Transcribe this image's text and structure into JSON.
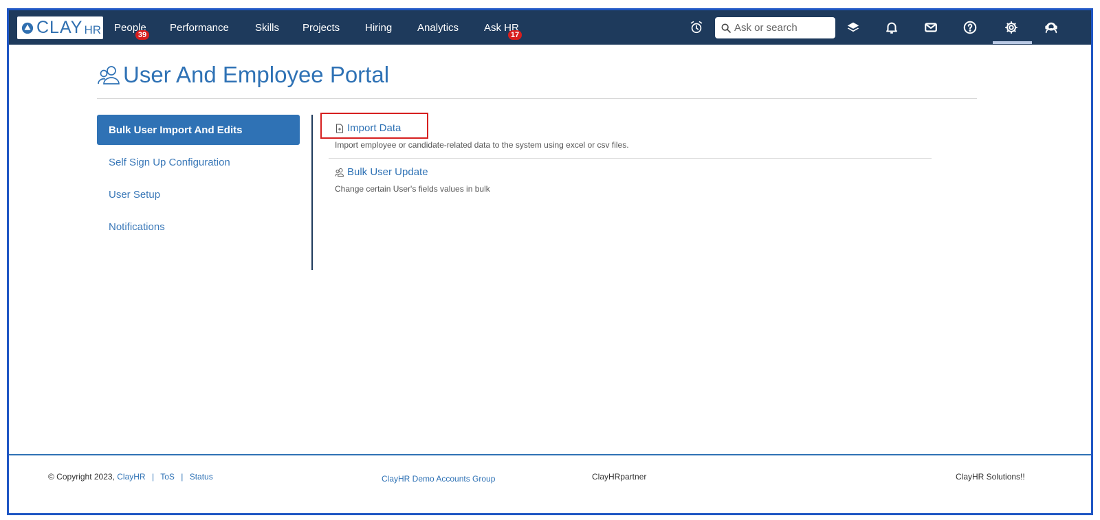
{
  "colors": {
    "navbar_bg": "#1e3a5c",
    "accent": "#2f72b5",
    "badge": "#d81e1e",
    "highlight": "#d61f1f",
    "frame": "#1f56c4"
  },
  "logo": {
    "text": "CLAY",
    "suffix": "HR",
    "icon": "clayhr-logo-icon"
  },
  "nav": {
    "items": [
      {
        "label": "People",
        "badge": "39"
      },
      {
        "label": "Performance"
      },
      {
        "label": "Skills"
      },
      {
        "label": "Projects"
      },
      {
        "label": "Hiring"
      },
      {
        "label": "Analytics"
      },
      {
        "label": "Ask HR",
        "badge": "17"
      }
    ],
    "icons": [
      "alarm-clock-icon",
      "layers-icon",
      "bell-icon",
      "mail-icon",
      "help-icon",
      "gear-icon",
      "support-agent-icon"
    ],
    "search": {
      "placeholder": "Ask or search",
      "value": "",
      "icon": "search-icon"
    }
  },
  "page": {
    "title": "User And Employee Portal",
    "title_icon": "users-icon"
  },
  "sidebar": {
    "items": [
      {
        "label": "Bulk User Import And Edits",
        "active": true
      },
      {
        "label": "Self Sign Up Configuration",
        "active": false
      },
      {
        "label": "User Setup",
        "active": false
      },
      {
        "label": "Notifications",
        "active": false
      }
    ]
  },
  "content": {
    "items": [
      {
        "title": "Import Data",
        "icon": "file-plus-icon",
        "description": "Import employee or candidate-related data to the system using excel or csv files."
      },
      {
        "title": "Bulk User Update",
        "icon": "users-icon",
        "description": "Change certain User's fields values in bulk"
      }
    ]
  },
  "footer": {
    "copyright": "© Copyright 2023,",
    "brand_link": "ClayHR",
    "sep": "|",
    "tos": "ToS",
    "status": "Status",
    "group": "ClayHR Demo Accounts Group",
    "partner": "ClayHRpartner",
    "solutions": "ClayHR Solutions!!"
  }
}
